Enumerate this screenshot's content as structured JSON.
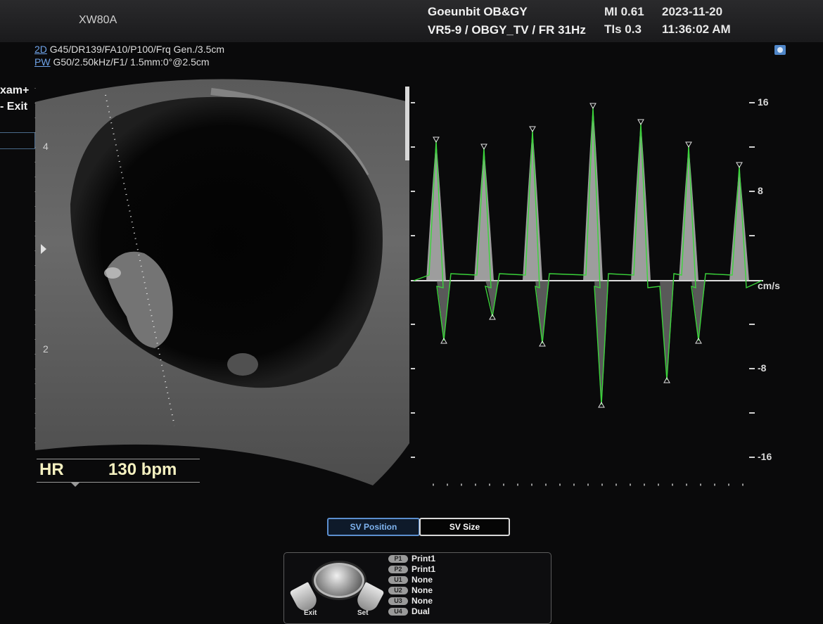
{
  "header": {
    "model": "XW80A",
    "institution": "Goeunbit OB&GY",
    "probe_preset": "VR5-9 / OBGY_TV / FR 31Hz",
    "mi": "MI  0.61",
    "tis": "TIs 0.3",
    "date": "2023-11-20",
    "time": "11:36:02 AM"
  },
  "params": {
    "mode_2d": "2D",
    "params_2d": " G45/DR139/FA10/P100/Frq Gen./3.5cm",
    "mode_pw": "PW",
    "params_pw": " G50/2.50kHz/F1/ 1.5mm:0°@2.5cm"
  },
  "sidebar": {
    "exam_plus": "xam+",
    "exit": "- Exit"
  },
  "depth_scale": [
    "4",
    "2"
  ],
  "velocity_scale": {
    "labels": [
      "16",
      "8",
      "-8",
      "-16"
    ],
    "unit": "cm/s"
  },
  "heart_rate": {
    "label": "HR",
    "value": "130 bpm"
  },
  "softkeys": {
    "sv_position": "SV Position",
    "sv_size": "SV Size"
  },
  "user_keys": [
    {
      "key": "P1",
      "value": "Print1"
    },
    {
      "key": "P2",
      "value": "Print1"
    },
    {
      "key": "U1",
      "value": "None"
    },
    {
      "key": "U2",
      "value": "None"
    },
    {
      "key": "U3",
      "value": "None"
    },
    {
      "key": "U4",
      "value": "Dual"
    }
  ],
  "trackball": {
    "left_label": "Exit",
    "right_label": "Set"
  },
  "colors": {
    "accent": "#5c8fcf",
    "trace": "#3bd43b",
    "hr_text": "#f4f0c0"
  }
}
